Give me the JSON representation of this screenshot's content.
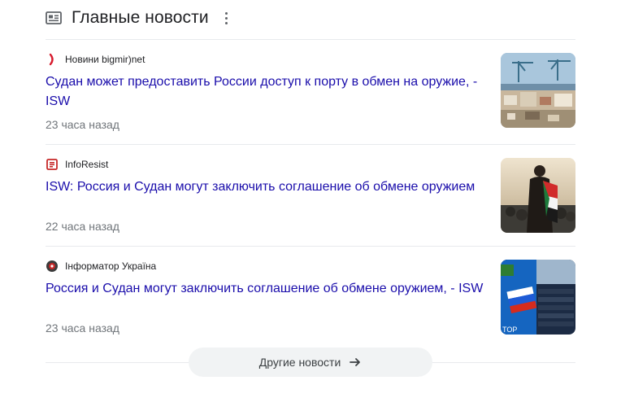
{
  "header": {
    "title": "Главные новости",
    "icon": "news-icon",
    "menu_icon": "more-vert-icon"
  },
  "items": [
    {
      "source": "Новини bigmir)net",
      "source_logo": "bigmir-logo",
      "headline": "Судан может предоставить России доступ к порту в обмен на оружие, - ISW",
      "time": "23 часа назад"
    },
    {
      "source": "InfoResist",
      "source_logo": "inforesist-logo",
      "headline": "ISW: Россия и Судан могут заключить соглашение об обмене оружием",
      "time": "22 часа назад"
    },
    {
      "source": "Інформатор Україна",
      "source_logo": "informator-logo",
      "headline": "Россия и Судан могут заключить соглашение об обмене оружием, - ISW",
      "time": "23 часа назад",
      "thumb_text": "TOP"
    }
  ],
  "more_button": {
    "label": "Другие новости",
    "icon": "arrow-right-icon"
  },
  "colors": {
    "link": "#1a0dab",
    "meta": "#70757a",
    "divider": "#e8eaed",
    "button_bg": "#f1f3f4"
  }
}
